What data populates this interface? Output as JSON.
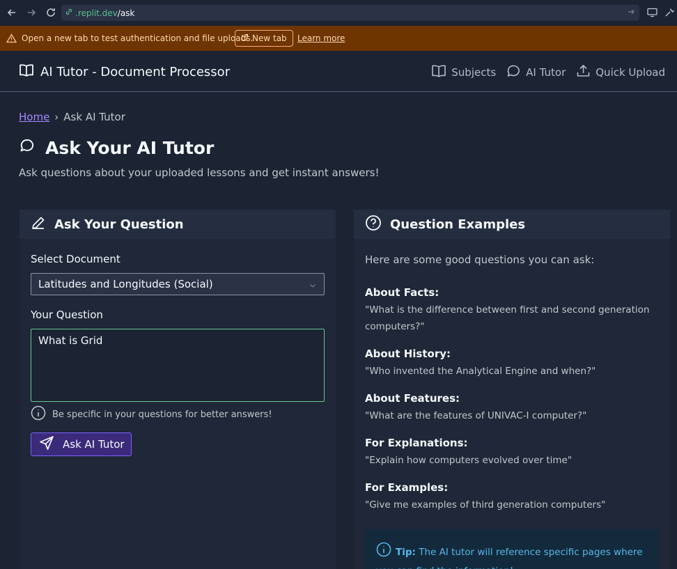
{
  "browser": {
    "url_host": ".replit.dev",
    "url_path": "/ask"
  },
  "banner": {
    "message": "Open a new tab to test authentication and file uploads.",
    "new_tab_label": "New tab",
    "learn_more_label": "Learn more"
  },
  "header": {
    "brand": "AI Tutor - Document Processor",
    "nav": [
      "Subjects",
      "AI Tutor",
      "Quick Upload"
    ]
  },
  "breadcrumb": {
    "home": "Home",
    "separator": "›",
    "current": "Ask AI Tutor"
  },
  "page": {
    "title": "Ask Your AI Tutor",
    "subtitle": "Ask questions about your uploaded lessons and get instant answers!"
  },
  "ask_card": {
    "title": "Ask Your Question",
    "document_label": "Select Document",
    "document_value": "Latitudes and Longitudes (Social)",
    "question_label": "Your Question",
    "question_value": "What is Grid",
    "hint": "Be specific in your questions for better answers!",
    "submit_label": "Ask AI Tutor"
  },
  "examples_card": {
    "title": "Question Examples",
    "intro": "Here are some good questions you can ask:",
    "examples": [
      {
        "category": "About Facts:",
        "question": "\"What is the difference between first and second generation computers?\""
      },
      {
        "category": "About History:",
        "question": "\"Who invented the Analytical Engine and when?\""
      },
      {
        "category": "About Features:",
        "question": "\"What are the features of UNIVAC-I computer?\""
      },
      {
        "category": "For Explanations:",
        "question": "\"Explain how computers evolved over time\""
      },
      {
        "category": "For Examples:",
        "question": "\"Give me examples of third generation computers\""
      }
    ],
    "tip_label": "Tip:",
    "tip_text": "The AI tutor will reference specific pages where you can find the information!"
  }
}
